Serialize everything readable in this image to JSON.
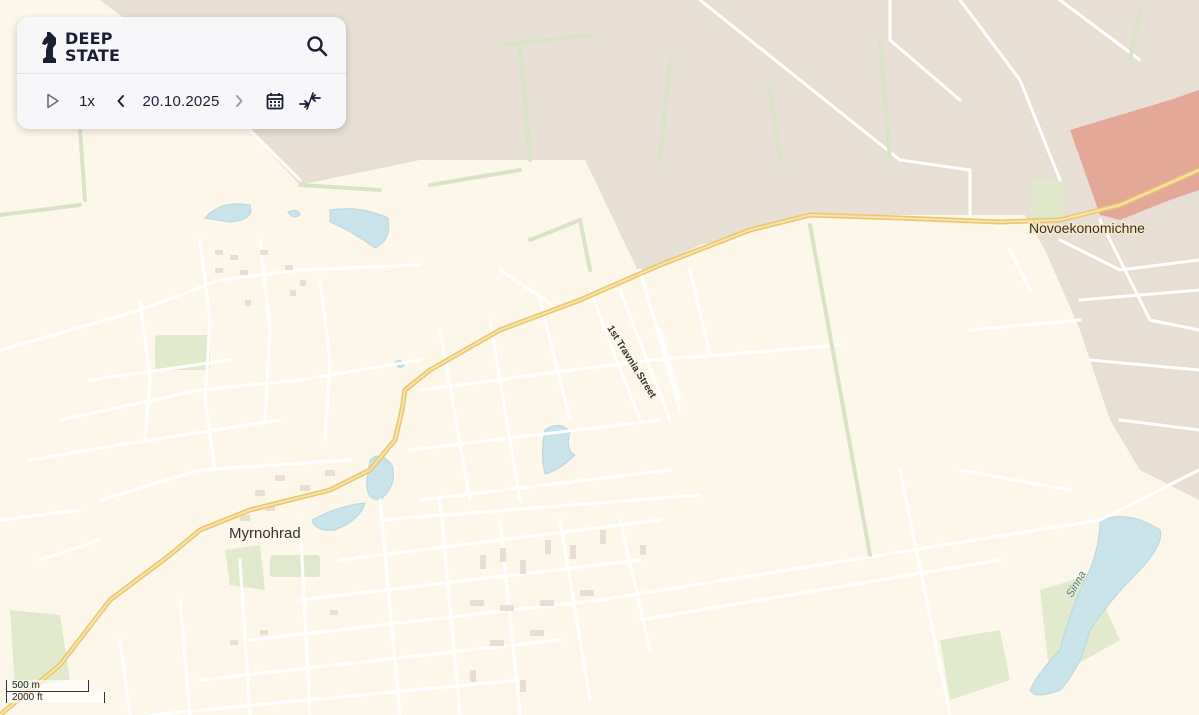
{
  "app": {
    "brand_line1": "DEEP",
    "brand_line2": "STATE"
  },
  "toolbar": {
    "play_icon": "play-icon",
    "speed": "1x",
    "prev_icon": "chevron-left-icon",
    "date": "20.10.2025",
    "next_icon": "chevron-right-icon",
    "calendar_icon": "calendar-icon",
    "compare_icon": "compress-arrows-icon",
    "search_icon": "search-icon"
  },
  "map": {
    "places": {
      "city": "Myrnohrad",
      "village": "Novoekonomichne",
      "street": "1st Travnia Street",
      "river": "Sinna"
    },
    "scale": {
      "metric": "500 m",
      "imperial": "2000 ft"
    },
    "colors": {
      "land": "#fdf7e9",
      "occupied_zone": "#e6ddd2",
      "contested_zone": "#e29a8a",
      "water": "#c9e3ea",
      "road_major": "#f2d58a",
      "road_minor": "#ffffff",
      "green": "#dfe8c9"
    }
  }
}
